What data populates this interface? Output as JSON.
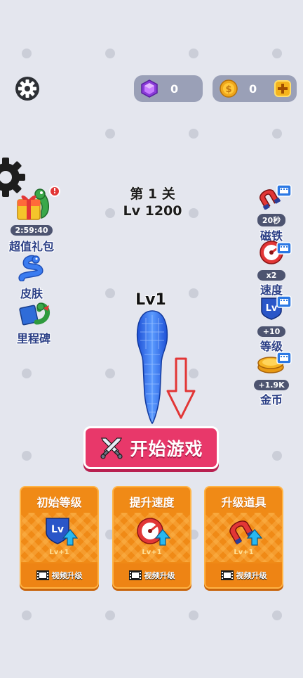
{
  "header": {
    "gems": "0",
    "coins": "0"
  },
  "level": {
    "stage": "第 1 关",
    "lv": "Lv 1200"
  },
  "left_menu": {
    "gift": {
      "timer": "2:59:40",
      "label": "超值礼包"
    },
    "skin": {
      "label": "皮肤"
    },
    "milestone": {
      "label": "里程碑"
    }
  },
  "right_menu": {
    "magnet": {
      "badge": "20秒",
      "label": "磁铁"
    },
    "speed": {
      "badge": "x2",
      "label": "速度"
    },
    "level": {
      "badge": "+10",
      "label": "等级",
      "icon_text": "Lv"
    },
    "coin": {
      "badge": "+1.9K",
      "label": "金币"
    }
  },
  "snake": {
    "level_label": "Lv1"
  },
  "start_button": {
    "label": "开始游戏"
  },
  "cards": [
    {
      "title": "初始等级",
      "lv": "Lv+1",
      "footer": "视频升级",
      "icon_text": "Lv"
    },
    {
      "title": "提升速度",
      "lv": "Lv+1",
      "footer": "视频升级"
    },
    {
      "title": "升级道具",
      "lv": "Lv+1",
      "footer": "视频升级"
    }
  ],
  "colors": {
    "background": "#e4e6ee",
    "start_button": "#e8386a",
    "card": "#f08a16",
    "snake": "#2f6cf0",
    "arrow": "#e23636"
  }
}
